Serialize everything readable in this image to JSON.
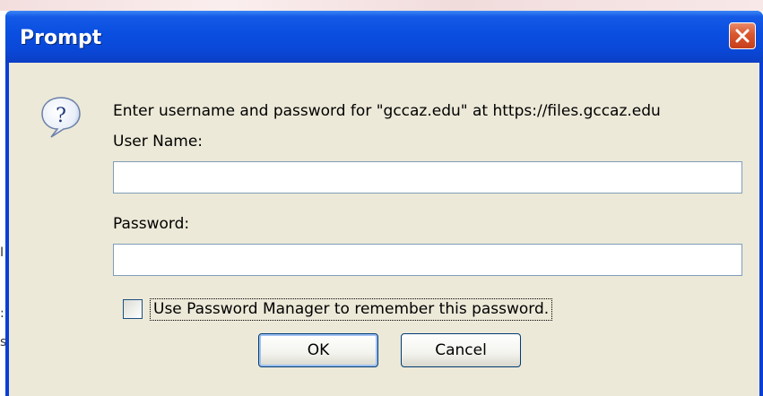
{
  "dialog": {
    "title": "Prompt",
    "message": "Enter username and password for \"gccaz.edu\" at https://files.gccaz.edu",
    "username_label": "User Name:",
    "username_value": "",
    "password_label": "Password:",
    "password_value": "",
    "remember_label": "Use Password Manager to remember this password.",
    "remember_checked": false,
    "ok_label": "OK",
    "cancel_label": "Cancel"
  },
  "background": {
    "glyphs": [
      "I",
      ":",
      "s"
    ]
  },
  "icons": {
    "title_close": "close-icon",
    "message_icon": "question-icon"
  },
  "colors": {
    "titlebar": "#0a4ee0",
    "client": "#ece9d8",
    "close_button": "#d9562e",
    "field_border": "#7f9db9"
  }
}
